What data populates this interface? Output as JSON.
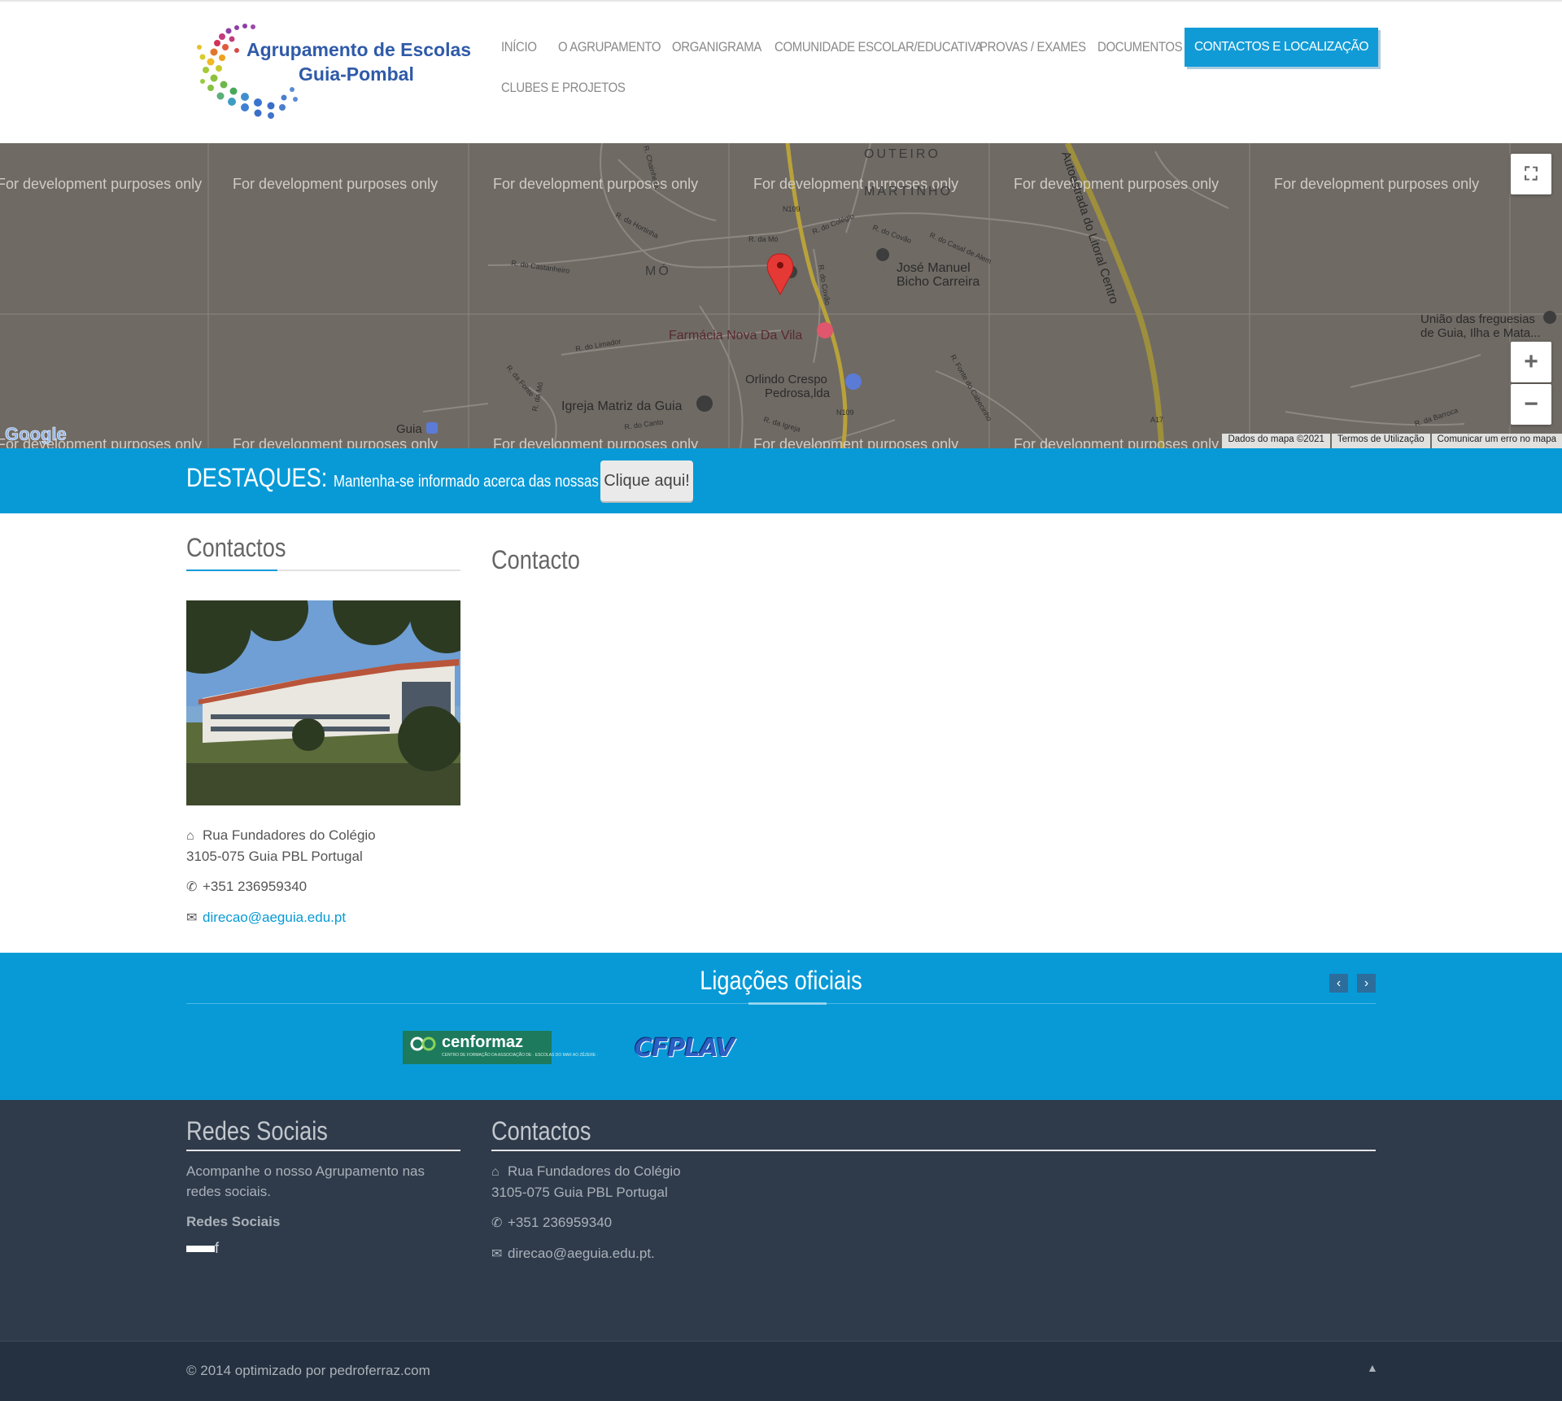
{
  "logo": {
    "line1": "Agrupamento de Escolas",
    "line2": "Guia-Pombal"
  },
  "nav": [
    {
      "label": "INÍCIO"
    },
    {
      "label": "O AGRUPAMENTO"
    },
    {
      "label": "ORGANIGRAMA"
    },
    {
      "label": "COMUNIDADE ESCOLAR/EDUCATIVA"
    },
    {
      "label": "PROVAS / EXAMES"
    },
    {
      "label": "DOCUMENTOS"
    },
    {
      "label": "CONTACTOS E LOCALIZAÇÃO",
      "active": true
    },
    {
      "label": "CLUBES E PROJETOS"
    }
  ],
  "map": {
    "watermark": "For development purposes only",
    "places": {
      "mo": "MÓ",
      "outeiro": "OUTEIRO",
      "martinho": "MARTINHO",
      "jose1": "José Manuel",
      "jose2": "Bicho Carreira",
      "farmacia": "Farmácia Nova Da Vila",
      "orlindo1": "Orlindo Crespo",
      "orlindo2": "Pedrosa,lda",
      "igreja": "Igreja Matriz da Guia",
      "guia": "Guia",
      "uniao1": "União das freguesias",
      "uniao2": "de Guia, Ilha e Mata...",
      "autoestrada": "Autoestrada do Litoral Centro"
    },
    "streets": {
      "n109a": "N109",
      "n109b": "N109",
      "a17": "A17",
      "rdamo": "R. da Mó",
      "rcolegio": "R. do Colégio",
      "rcovao": "R. do Covão",
      "rcasal": "R. do Casal de Alem",
      "rhortinha": "R. da Hortinha",
      "rcastanheiro": "R. do Castanheiro",
      "rlimador": "R. do Limador",
      "rfonte": "R. da Fonte",
      "rdomo2": "R. da Mó",
      "rcanto": "R. do Canto",
      "rigreja": "R. da Igreja",
      "rbarroca": "R. da Barroca",
      "rcovao2": "R. do Covão",
      "rfontec": "R. Fonte do Cabecinho",
      "rchaos": "R. Chainheca"
    },
    "google": "Google",
    "footer": {
      "data": "Dados do mapa ©2021",
      "terms": "Termos de Utilização",
      "report": "Comunicar um erro no mapa"
    }
  },
  "destaques": {
    "label": "DESTAQUES:",
    "text": "Mantenha-se informado acerca das nossas atividades",
    "button": "Clique aqui!"
  },
  "contactos": {
    "title": "Contactos",
    "address1": "Rua Fundadores do Colégio",
    "address2": "3105-075 Guia PBL Portugal",
    "phone": "+351 236959340",
    "email": "direcao@aeguia.edu.pt"
  },
  "contacto": {
    "title": "Contacto"
  },
  "ligacoes": {
    "title": "Ligações oficiais",
    "prev": "‹",
    "next": "›",
    "logo1_main": "cenformaz",
    "logo1_sub": "CENTRO DE FORMAÇÃO DA ASSOCIAÇÃO DE · ESCOLAS DO MAR AO ZÊZERE ·",
    "logo2": "CFPLAV"
  },
  "footer": {
    "social_title": "Redes Sociais",
    "social_text": "Acompanhe o nosso Agrupamento nas redes sociais.",
    "social_sub": "Redes Sociais",
    "facebook": "f",
    "contact_title": "Contactos",
    "address1": "Rua Fundadores do Colégio",
    "address2": "3105-075 Guia PBL Portugal",
    "phone": "+351 236959340",
    "email": "direcao@aeguia.edu.pt."
  },
  "bottom": {
    "copyright": "© 2014 optimizado por pedroferraz.com",
    "up": "▲"
  },
  "colors": {
    "accent": "#079ad7",
    "footer": "#2f3b4b",
    "map_bg": "#6f6a64",
    "pin": "#e53935"
  }
}
